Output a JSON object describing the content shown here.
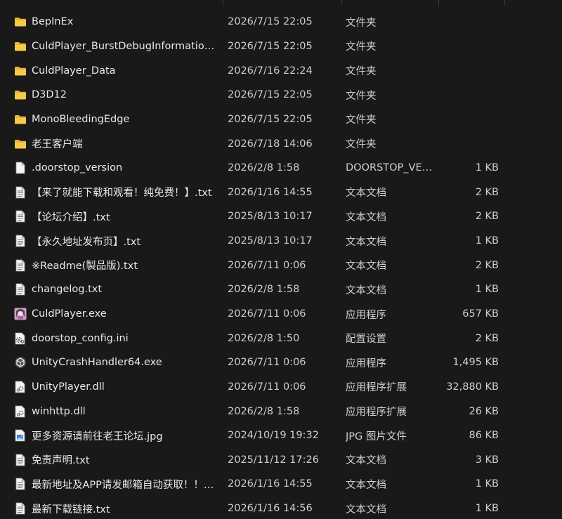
{
  "files": [
    {
      "name": "BepInEx",
      "date": "2026/7/15 22:05",
      "type": "文件夹",
      "size": "",
      "icon": "folder-icon"
    },
    {
      "name": "CuldPlayer_BurstDebugInformation_...",
      "date": "2026/7/15 22:05",
      "type": "文件夹",
      "size": "",
      "icon": "folder-icon"
    },
    {
      "name": "CuldPlayer_Data",
      "date": "2026/7/16 22:24",
      "type": "文件夹",
      "size": "",
      "icon": "folder-icon"
    },
    {
      "name": "D3D12",
      "date": "2026/7/15 22:05",
      "type": "文件夹",
      "size": "",
      "icon": "folder-icon"
    },
    {
      "name": "MonoBleedingEdge",
      "date": "2026/7/15 22:05",
      "type": "文件夹",
      "size": "",
      "icon": "folder-icon"
    },
    {
      "name": "老王客户端",
      "date": "2026/7/18 14:06",
      "type": "文件夹",
      "size": "",
      "icon": "folder-icon"
    },
    {
      "name": ".doorstop_version",
      "date": "2026/2/8 1:58",
      "type": "DOORSTOP_VER...",
      "size": "1 KB",
      "icon": "blank-file-icon"
    },
    {
      "name": "【来了就能下载和观看！纯免费！】.txt",
      "date": "2026/1/16 14:55",
      "type": "文本文档",
      "size": "2 KB",
      "icon": "text-file-icon"
    },
    {
      "name": "【论坛介绍】.txt",
      "date": "2025/8/13 10:17",
      "type": "文本文档",
      "size": "2 KB",
      "icon": "text-file-icon"
    },
    {
      "name": "【永久地址发布页】.txt",
      "date": "2025/8/13 10:17",
      "type": "文本文档",
      "size": "1 KB",
      "icon": "text-file-icon"
    },
    {
      "name": "※Readme(製品版).txt",
      "date": "2026/7/11 0:06",
      "type": "文本文档",
      "size": "2 KB",
      "icon": "text-file-icon"
    },
    {
      "name": "changelog.txt",
      "date": "2026/2/8 1:58",
      "type": "文本文档",
      "size": "1 KB",
      "icon": "text-file-icon"
    },
    {
      "name": "CuldPlayer.exe",
      "date": "2026/7/11 0:06",
      "type": "应用程序",
      "size": "657 KB",
      "icon": "app-exe-icon"
    },
    {
      "name": "doorstop_config.ini",
      "date": "2026/2/8 1:50",
      "type": "配置设置",
      "size": "2 KB",
      "icon": "config-file-icon"
    },
    {
      "name": "UnityCrashHandler64.exe",
      "date": "2026/7/11 0:06",
      "type": "应用程序",
      "size": "1,495 KB",
      "icon": "unity-icon"
    },
    {
      "name": "UnityPlayer.dll",
      "date": "2026/7/11 0:06",
      "type": "应用程序扩展",
      "size": "32,880 KB",
      "icon": "dll-file-icon"
    },
    {
      "name": "winhttp.dll",
      "date": "2026/2/8 1:58",
      "type": "应用程序扩展",
      "size": "26 KB",
      "icon": "dll-file-icon"
    },
    {
      "name": "更多资源请前往老王论坛.jpg",
      "date": "2024/10/19 19:32",
      "type": "JPG 图片文件",
      "size": "86 KB",
      "icon": "image-file-icon"
    },
    {
      "name": "免责声明.txt",
      "date": "2025/11/12 17:26",
      "type": "文本文档",
      "size": "3 KB",
      "icon": "text-file-icon"
    },
    {
      "name": "最新地址及APP请发邮箱自动获取！！！...",
      "date": "2026/1/16 14:55",
      "type": "文本文档",
      "size": "1 KB",
      "icon": "text-file-icon"
    },
    {
      "name": "最新下载链接.txt",
      "date": "2026/1/16 14:56",
      "type": "文本文档",
      "size": "1 KB",
      "icon": "text-file-icon"
    }
  ]
}
